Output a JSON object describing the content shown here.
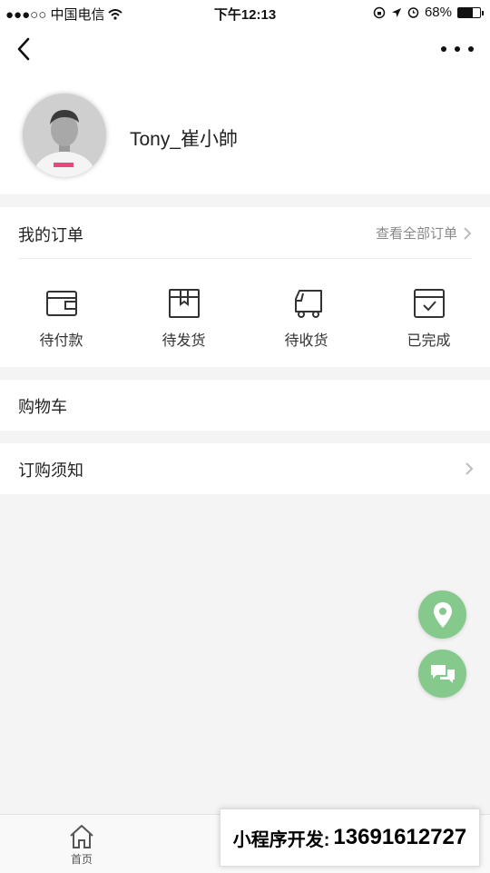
{
  "status_bar": {
    "carrier": "●●●○○ 中国电信",
    "time": "下午12:13",
    "battery": "68%",
    "battery_level": 0.68
  },
  "profile": {
    "username": "Tony_崔小帥"
  },
  "orders": {
    "title": "我的订单",
    "view_all": "查看全部订单",
    "items": [
      {
        "label": "待付款",
        "icon": "wallet-icon"
      },
      {
        "label": "待发货",
        "icon": "package-icon"
      },
      {
        "label": "待收货",
        "icon": "truck-icon"
      },
      {
        "label": "已完成",
        "icon": "completed-box-icon"
      }
    ]
  },
  "menu": {
    "cart": "购物车",
    "notice": "订购须知"
  },
  "tabbar": {
    "home": "首页"
  },
  "ad": {
    "label": "小程序开发:",
    "phone": "13691612727"
  },
  "colors": {
    "fab": "#86c98c",
    "background": "#f4f4f4"
  }
}
